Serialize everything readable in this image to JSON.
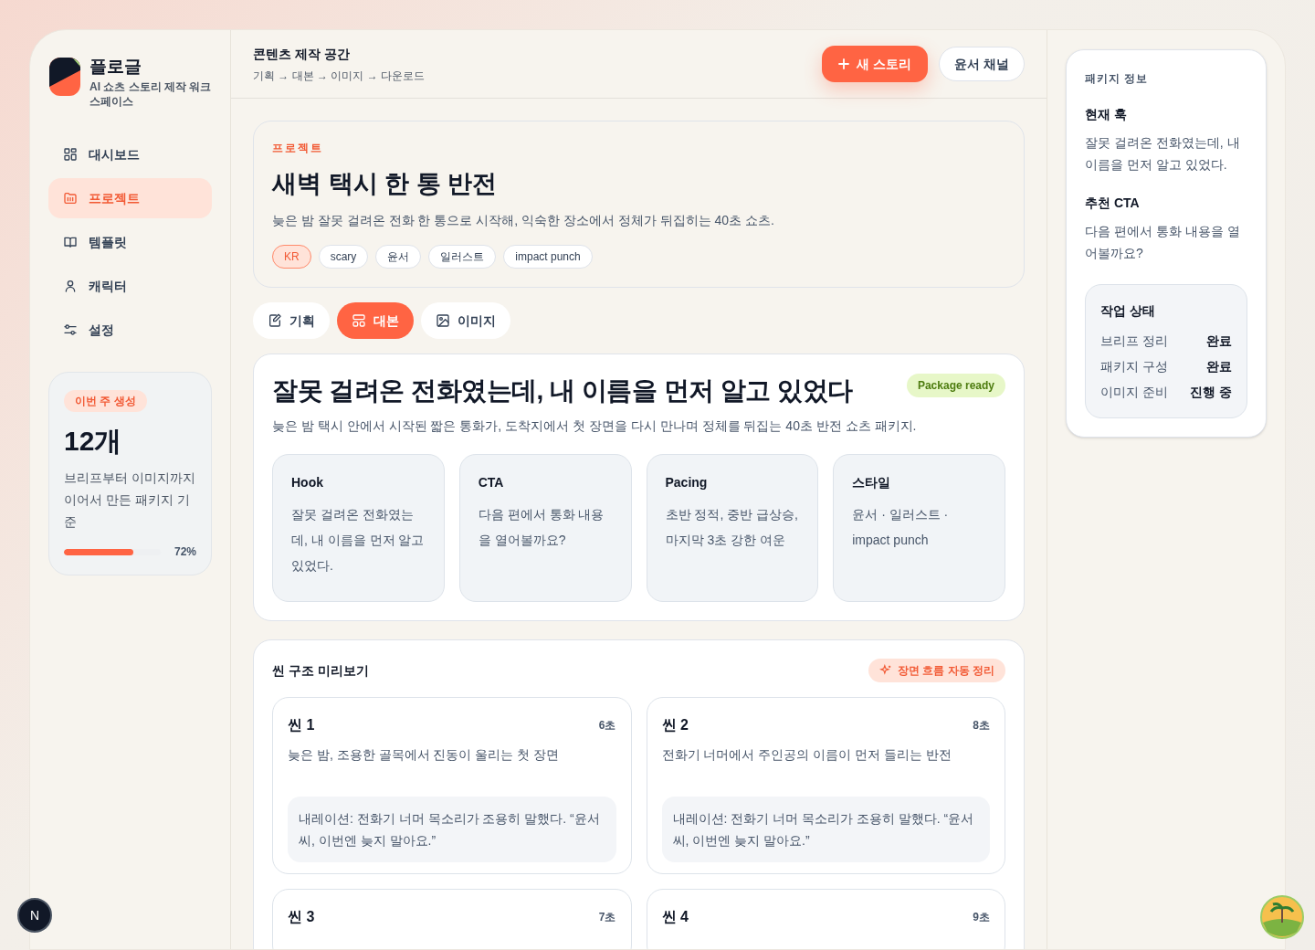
{
  "brand": {
    "name": "플로글",
    "tagline": "AI 쇼츠 스토리 제작 워크스페이스"
  },
  "nav": [
    {
      "label": "대시보드",
      "selected": false
    },
    {
      "label": "프로젝트",
      "selected": true
    },
    {
      "label": "템플릿",
      "selected": false
    },
    {
      "label": "캐릭터",
      "selected": false
    },
    {
      "label": "설정",
      "selected": false
    }
  ],
  "weekly": {
    "badge": "이번 주 생성",
    "count": "12개",
    "description": "브리프부터 이미지까지 이어서 만든 패키지 기준",
    "level": 0.72,
    "percent": "72%"
  },
  "header": {
    "title": "콘텐츠 제작 공간",
    "breadcrumb": "기획 → 대본 → 이미지 → 다운로드",
    "primary_button": "새 스토리",
    "secondary_button": "윤서 채널"
  },
  "project": {
    "eyebrow": "프로젝트",
    "title": "새벽 택시 한 통 반전",
    "description": "늦은 밤 잘못 걸려온 전화 한 통으로 시작해, 익숙한 장소에서 정체가 뒤집히는 40초 쇼츠.",
    "tags": [
      {
        "label": "KR",
        "kind": "accent"
      },
      {
        "label": "scary",
        "kind": "plain"
      },
      {
        "label": "윤서",
        "kind": "plain"
      },
      {
        "label": "일러스트",
        "kind": "plain"
      },
      {
        "label": "impact punch",
        "kind": "plain"
      }
    ]
  },
  "tabs": [
    {
      "label": "기획",
      "selected": false
    },
    {
      "label": "대본",
      "selected": true
    },
    {
      "label": "이미지",
      "selected": false
    }
  ],
  "package": {
    "title": "잘못 걸려온 전화였는데, 내 이름을 먼저 알고 있었다",
    "status": "Package ready",
    "summary": "늦은 밤 택시 안에서 시작된 짧은 통화가, 도착지에서 첫 장면을 다시 만나며 정체를 뒤집는 40초 반전 쇼츠 패키지.",
    "cards": [
      {
        "title": "Hook",
        "text": "잘못 걸려온 전화였는데, 내 이름을 먼저 알고 있었다."
      },
      {
        "title": "CTA",
        "text": "다음 편에서 통화 내용을 열어볼까요?"
      },
      {
        "title": "Pacing",
        "text": "초반 정적, 중반 급상승, 마지막 3초 강한 여운"
      },
      {
        "title": "스타일",
        "text": "윤서 · 일러스트 · impact punch"
      }
    ]
  },
  "scenes": {
    "title": "씬 구조 미리보기",
    "action": "장면 흐름 자동 정리",
    "items": [
      {
        "title": "씬 1",
        "duration": "6초",
        "description": "늦은 밤, 조용한 골목에서 진동이 울리는 첫 장면",
        "narration": "내레이션: 전화기 너머 목소리가 조용히 말했다. “윤서 씨, 이번엔 늦지 말아요.”"
      },
      {
        "title": "씬 2",
        "duration": "8초",
        "description": "전화기 너머에서 주인공의 이름이 먼저 들리는 반전",
        "narration": "내레이션: 전화기 너머 목소리가 조용히 말했다. “윤서 씨, 이번엔 늦지 말아요.”"
      },
      {
        "title": "씬 3",
        "duration": "7초"
      },
      {
        "title": "씬 4",
        "duration": "9초"
      }
    ]
  },
  "info": {
    "heading": "패키지 정보",
    "sections": [
      {
        "title": "현재 훅",
        "text": "잘못 걸려온 전화였는데, 내 이름을 먼저 알고 있었다."
      },
      {
        "title": "추천 CTA",
        "text": "다음 편에서 통화 내용을 열어볼까요?"
      }
    ],
    "status": {
      "title": "작업 상태",
      "rows": [
        {
          "label": "브리프 정리",
          "value": "완료"
        },
        {
          "label": "패키지 구성",
          "value": "완료"
        },
        {
          "label": "이미지 준비",
          "value": "진행 중"
        }
      ]
    }
  },
  "dev_badge": "N"
}
